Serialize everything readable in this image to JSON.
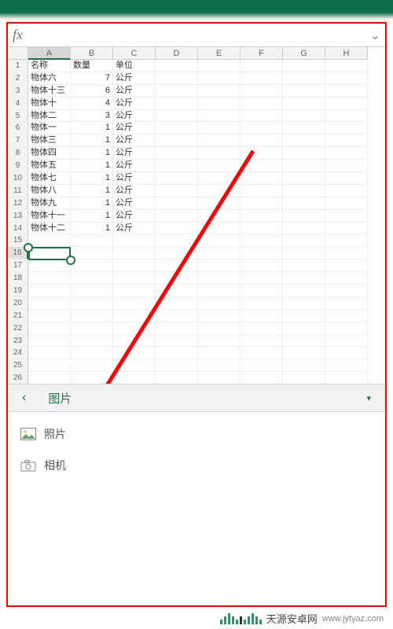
{
  "formula_bar": {
    "fx": "fx"
  },
  "columns": [
    "A",
    "B",
    "C",
    "D",
    "E",
    "F",
    "G",
    "H"
  ],
  "headers": {
    "c0": "名称",
    "c1": "数量",
    "c2": "单位"
  },
  "rows": [
    {
      "c0": "物体六",
      "c1": "7",
      "c2": "公斤"
    },
    {
      "c0": "物体十三",
      "c1": "6",
      "c2": "公斤"
    },
    {
      "c0": "物体十",
      "c1": "4",
      "c2": "公斤"
    },
    {
      "c0": "物体二",
      "c1": "3",
      "c2": "公斤"
    },
    {
      "c0": "物体一",
      "c1": "1",
      "c2": "公斤"
    },
    {
      "c0": "物体三",
      "c1": "1",
      "c2": "公斤"
    },
    {
      "c0": "物体四",
      "c1": "1",
      "c2": "公斤"
    },
    {
      "c0": "物体五",
      "c1": "1",
      "c2": "公斤"
    },
    {
      "c0": "物体七",
      "c1": "1",
      "c2": "公斤"
    },
    {
      "c0": "物体八",
      "c1": "1",
      "c2": "公斤"
    },
    {
      "c0": "物体九",
      "c1": "1",
      "c2": "公斤"
    },
    {
      "c0": "物体十一",
      "c1": "1",
      "c2": "公斤"
    },
    {
      "c0": "物体十二",
      "c1": "1",
      "c2": "公斤"
    }
  ],
  "visible_row_count": 26,
  "selected_cell": {
    "row": 16,
    "col": "A"
  },
  "tab": {
    "label": "图片"
  },
  "menu": {
    "photos": "照片",
    "camera": "相机"
  },
  "watermark": {
    "name": "天源安卓网",
    "site": "www.jytyaz.com"
  },
  "colors": {
    "accent": "#217346",
    "annotate": "#ff0000"
  }
}
